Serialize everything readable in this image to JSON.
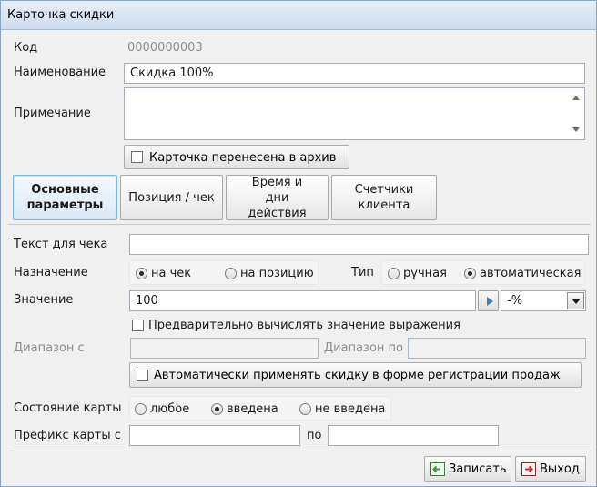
{
  "window": {
    "title": "Карточка скидки"
  },
  "code": {
    "label": "Код",
    "value": "0000000003"
  },
  "name": {
    "label": "Наименование",
    "value": "Скидка 100%"
  },
  "note": {
    "label": "Примечание",
    "value": ""
  },
  "archive": {
    "label": "Карточка перенесена в архив",
    "checked": false
  },
  "tabs": [
    {
      "label": "Основные параметры",
      "active": true
    },
    {
      "label": "Позиция / чек",
      "active": false
    },
    {
      "label": "Время и дни действия",
      "active": false
    },
    {
      "label": "Счетчики клиента",
      "active": false
    }
  ],
  "receipt_text": {
    "label": "Текст для чека",
    "value": ""
  },
  "purpose": {
    "label": "Назначение",
    "options": [
      "на чек",
      "на позицию"
    ],
    "selected": "на чек"
  },
  "type": {
    "label": "Тип",
    "options": [
      "ручная",
      "автоматическая"
    ],
    "selected": "автоматическая"
  },
  "value": {
    "label": "Значение",
    "value": "100",
    "unit": "-%",
    "button_icon": "play-arrow-icon"
  },
  "precalc": {
    "label": "Предварительно вычислять значение выражения",
    "checked": false
  },
  "range": {
    "from_label": "Диапазон с",
    "to_label": "Диапазон по",
    "from_value": "",
    "to_value": ""
  },
  "auto_apply": {
    "label": "Автоматически применять скидку в форме регистрации продаж",
    "checked": false
  },
  "card_state": {
    "label": "Состояние карты",
    "options": [
      "любое",
      "введена",
      "не введена"
    ],
    "selected": "введена"
  },
  "card_prefix": {
    "label": "Префикс карты с",
    "to_label": "по",
    "from_value": "",
    "to_value": ""
  },
  "footer": {
    "save_label": "Записать",
    "exit_label": "Выход",
    "save_icon": "save-icon",
    "exit_icon": "exit-icon"
  },
  "colors": {
    "active_tab_border": "#79b5e5",
    "titlebar": "#dce6f2"
  }
}
